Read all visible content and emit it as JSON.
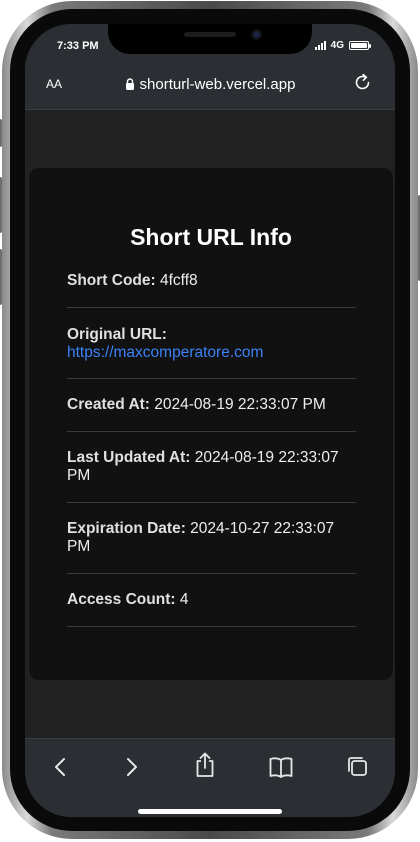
{
  "status_bar": {
    "time": "7:33 PM",
    "network": "4G"
  },
  "address_bar": {
    "text_size_label": "AA",
    "url": "shorturl-web.vercel.app"
  },
  "card": {
    "title": "Short URL Info",
    "fields": [
      {
        "label": "Short Code:",
        "value": "4fcff8"
      },
      {
        "label": "Original URL:",
        "value": "https://maxcomperatore.com"
      },
      {
        "label": "Created At:",
        "value": "2024-08-19 22:33:07 PM"
      },
      {
        "label": "Last Updated At:",
        "value": "2024-08-19 22:33:07 PM"
      },
      {
        "label": "Expiration Date:",
        "value": "2024-10-27 22:33:07 PM"
      },
      {
        "label": "Access Count:",
        "value": "4"
      }
    ]
  },
  "toolbar": {
    "icons": [
      "back-icon",
      "forward-icon",
      "share-icon",
      "bookmarks-icon",
      "tabs-icon"
    ]
  },
  "colors": {
    "link": "#3b82f6",
    "card_background": "#111111",
    "page_background": "#212121",
    "bar_background": "#2b2f33"
  }
}
